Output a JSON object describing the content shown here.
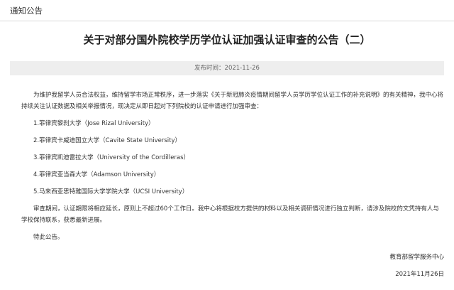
{
  "header": {
    "section_title": "通知公告"
  },
  "article": {
    "title": "关于对部分国外院校学历学位认证加强认证审查的公告（二）",
    "publish_time": "发布时间：2021-11-26",
    "intro": "为维护我留学人员合法权益，维持留学市场正常秩序，进一步落实《关于新冠肺炎疫情期间留学人员学历学位认证工作的补充说明》的有关精神，我中心将持续关注认证数据及相关举报情况，现决定从即日起对下列院校的认证申请进行加强审查：",
    "institutions": [
      "1.菲律宾黎刹大学（Jose Rizal University）",
      "2.菲律宾卡威迪国立大学（Cavite State University）",
      "3.菲律宾凯迪雷拉大学（University of the Cordilleras）",
      "4.菲律宾亚当森大学（Adamson University）",
      "5.马来西亚思特雅国际大学学院大学（UCSI University）"
    ],
    "review_note": "审查期间，认证期限将相应延长，原则上不超过60个工作日。我中心将根据校方提供的材料以及相关调研情况进行独立判断，请涉及院校的文凭持有人与学校保持联系，获悉最新进展。",
    "closing": "特此公告。",
    "signature_org": "教育部留学服务中心",
    "signature_date": "2021年11月26日"
  }
}
